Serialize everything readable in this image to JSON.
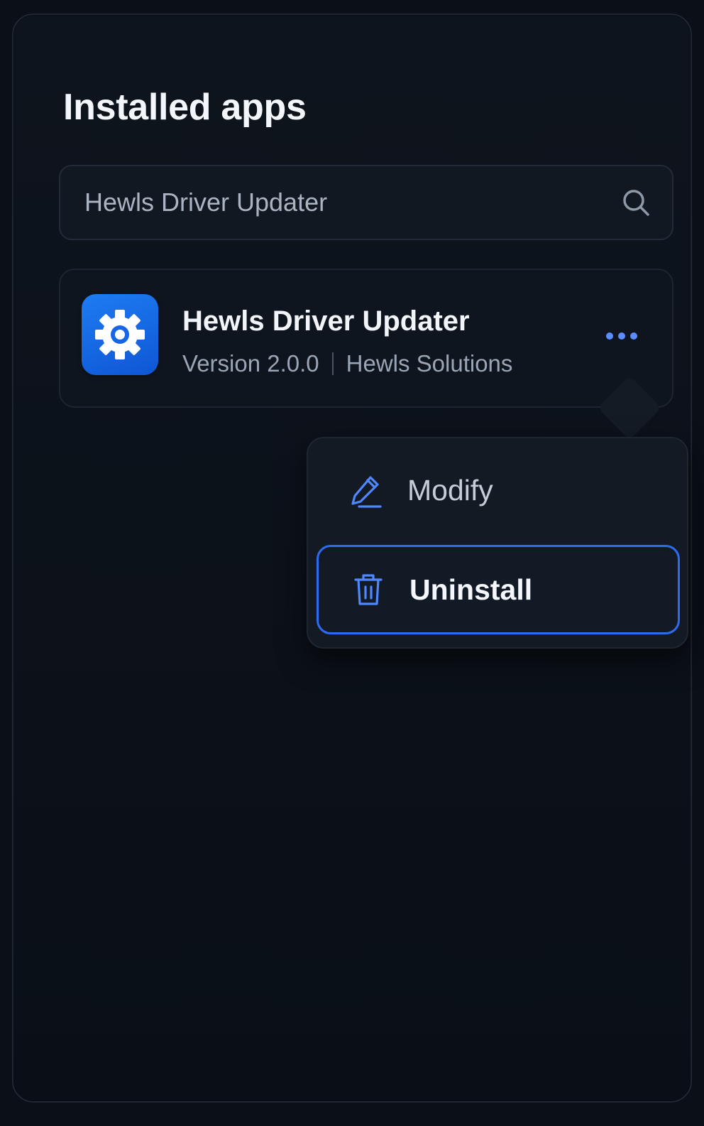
{
  "header": {
    "title": "Installed apps"
  },
  "search": {
    "value": "Hewls Driver Updater",
    "icon": "search-icon"
  },
  "app": {
    "name": "Hewls Driver Updater",
    "version": "Version 2.0.0",
    "publisher": "Hewls Solutions",
    "icon": "gear-icon",
    "icon_color": "#1565e8"
  },
  "menu": {
    "items": [
      {
        "label": "Modify",
        "icon": "pencil-icon",
        "selected": false
      },
      {
        "label": "Uninstall",
        "icon": "trash-icon",
        "selected": true
      }
    ]
  },
  "colors": {
    "accent": "#2f6bf0",
    "background": "#0a0f18"
  }
}
